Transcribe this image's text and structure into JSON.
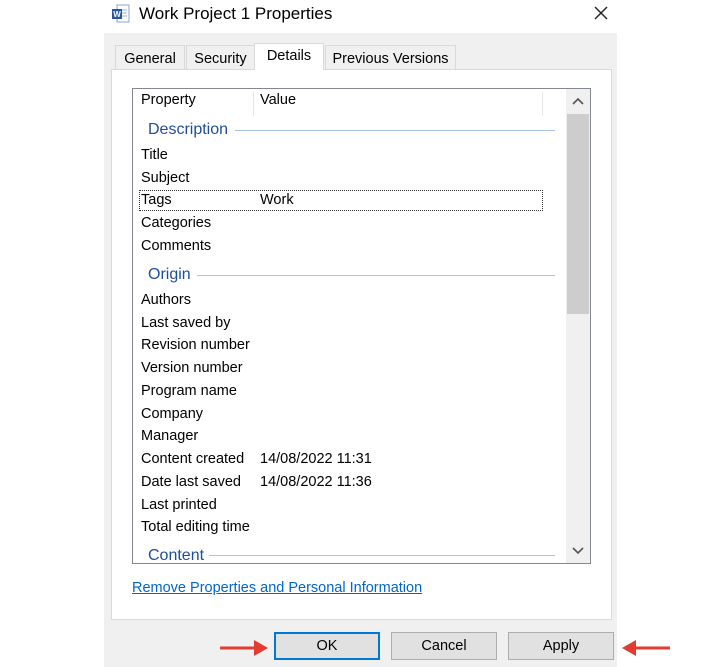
{
  "window": {
    "title": "Work Project 1 Properties"
  },
  "tabs": [
    {
      "label": "General"
    },
    {
      "label": "Security"
    },
    {
      "label": "Details"
    },
    {
      "label": "Previous Versions"
    }
  ],
  "details": {
    "columns": {
      "property": "Property",
      "value": "Value"
    },
    "groups": {
      "description": {
        "label": "Description",
        "rows": [
          {
            "name": "Title",
            "value": ""
          },
          {
            "name": "Subject",
            "value": ""
          },
          {
            "name": "Tags",
            "value": "Work"
          },
          {
            "name": "Categories",
            "value": ""
          },
          {
            "name": "Comments",
            "value": ""
          }
        ]
      },
      "origin": {
        "label": "Origin",
        "rows": [
          {
            "name": "Authors",
            "value": ""
          },
          {
            "name": "Last saved by",
            "value": ""
          },
          {
            "name": "Revision number",
            "value": ""
          },
          {
            "name": "Version number",
            "value": ""
          },
          {
            "name": "Program name",
            "value": ""
          },
          {
            "name": "Company",
            "value": ""
          },
          {
            "name": "Manager",
            "value": ""
          },
          {
            "name": "Content created",
            "value": "14/08/2022 11:31"
          },
          {
            "name": "Date last saved",
            "value": "14/08/2022 11:36"
          },
          {
            "name": "Last printed",
            "value": ""
          },
          {
            "name": "Total editing time",
            "value": ""
          }
        ]
      },
      "content": {
        "label": "Content"
      }
    }
  },
  "links": {
    "remove_properties": "Remove Properties and Personal Information"
  },
  "buttons": {
    "ok": "OK",
    "cancel": "Cancel",
    "apply": "Apply"
  },
  "colors": {
    "accent": "#0078d7",
    "group_heading": "#1e4e9a",
    "link": "#0066cc",
    "arrow": "#e03c31"
  }
}
